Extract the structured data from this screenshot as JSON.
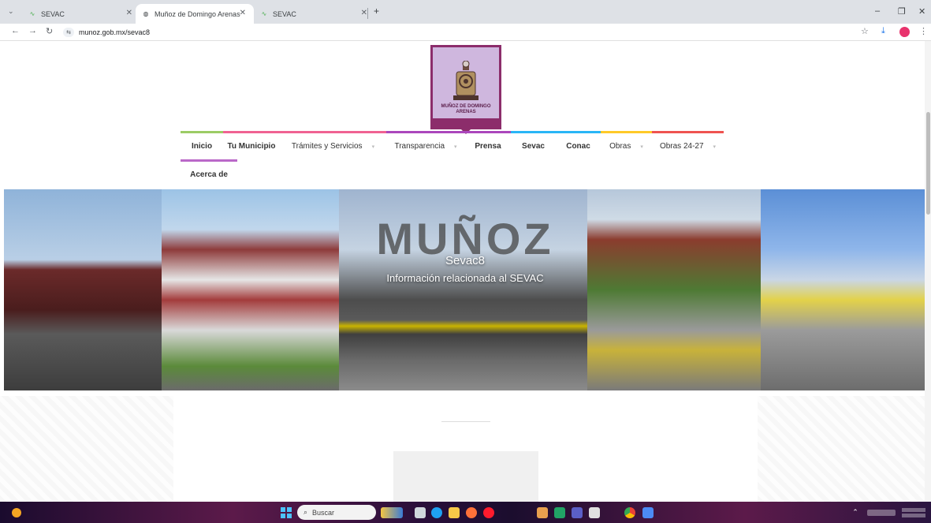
{
  "browser": {
    "tabs": [
      {
        "title": "SEVAC",
        "active": false
      },
      {
        "title": "Muñoz de Domingo Arenas",
        "active": true
      },
      {
        "title": "SEVAC",
        "active": false
      }
    ],
    "new_tab": "+",
    "url": "munoz.gob.mx/sevac8",
    "window": {
      "minimize": "–",
      "maximize": "❐",
      "close": "✕"
    }
  },
  "site": {
    "logo_text": "MUÑOZ DE DOMINGO ARENAS",
    "menu": [
      {
        "label": "Inicio",
        "active": true,
        "dropdown": false
      },
      {
        "label": "Tu Municipio",
        "active": false,
        "dropdown": false
      },
      {
        "label": "Trámites y Servicios",
        "active": false,
        "dropdown": true
      },
      {
        "label": "Transparencia",
        "active": false,
        "dropdown": true
      },
      {
        "label": "Prensa",
        "active": false,
        "dropdown": false
      },
      {
        "label": "Sevac",
        "active": false,
        "dropdown": false
      },
      {
        "label": "Conac",
        "active": false,
        "dropdown": false
      },
      {
        "label": "Obras",
        "active": false,
        "dropdown": true
      },
      {
        "label": "Obras 24-27",
        "active": false,
        "dropdown": true
      },
      {
        "label": "Acerca de",
        "active": false,
        "dropdown": false
      }
    ],
    "banner": {
      "big_text": "MUÑOZ",
      "title": "Sevac8",
      "subtitle": "Información relacionada al SEVAC"
    }
  },
  "taskbar": {
    "search_placeholder": "Buscar"
  },
  "colors": {
    "accent_purple": "#8c2d6b",
    "menu_active": "#9ccc65"
  }
}
